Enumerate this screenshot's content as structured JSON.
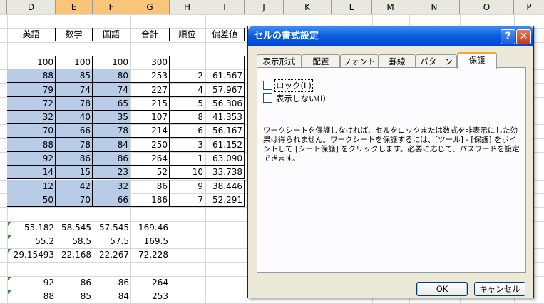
{
  "columns": [
    "D",
    "E",
    "F",
    "G",
    "H",
    "I",
    "J",
    "K",
    "L",
    "M",
    "N",
    "O",
    "P"
  ],
  "rows": [
    [],
    [
      "英語",
      "数学",
      "国語",
      "合計",
      "順位",
      "偏差値"
    ],
    [],
    [
      "100",
      "100",
      "100",
      "300",
      "",
      ""
    ],
    [
      "88",
      "85",
      "80",
      "253",
      "2",
      "61.567"
    ],
    [
      "79",
      "74",
      "74",
      "227",
      "4",
      "57.967"
    ],
    [
      "72",
      "78",
      "65",
      "215",
      "5",
      "56.306"
    ],
    [
      "32",
      "40",
      "35",
      "107",
      "8",
      "41.353"
    ],
    [
      "70",
      "66",
      "78",
      "214",
      "6",
      "56.167"
    ],
    [
      "88",
      "78",
      "84",
      "250",
      "3",
      "61.152"
    ],
    [
      "92",
      "86",
      "86",
      "264",
      "1",
      "63.090"
    ],
    [
      "14",
      "15",
      "23",
      "52",
      "10",
      "33.738"
    ],
    [
      "12",
      "42",
      "32",
      "86",
      "9",
      "38.446"
    ],
    [
      "50",
      "70",
      "66",
      "186",
      "7",
      "52.291"
    ],
    [],
    [
      "55.182",
      "58.545",
      "57.545",
      "169.46",
      "",
      ""
    ],
    [
      "55.2",
      "58.5",
      "57.5",
      "169.5",
      "",
      ""
    ],
    [
      "29.15493",
      "22.168",
      "22.267",
      "72.228",
      "",
      ""
    ],
    [],
    [
      "92",
      "86",
      "86",
      "264",
      "",
      ""
    ],
    [
      "88",
      "85",
      "84",
      "253",
      "",
      ""
    ]
  ],
  "dialog": {
    "title": "セルの書式設定",
    "help_glyph": "?",
    "close_glyph": "✕",
    "tabs": [
      "表示形式",
      "配置",
      "フォント",
      "罫線",
      "パターン",
      "保護"
    ],
    "active_tab": "保護",
    "lock_label": "ロック(L)",
    "hidden_label": "表示しない(I)",
    "lock_checked": false,
    "hidden_checked": false,
    "note": "ワークシートを保護しなければ、セルをロックまたは数式を非表示にした効果は得られません。ワークシートを保護するには、[ツール] - [保護] をポイントして [シート保護] をクリックします。必要に応じて、パスワードを設定できます。",
    "ok_label": "OK",
    "cancel_label": "キャンセル"
  }
}
